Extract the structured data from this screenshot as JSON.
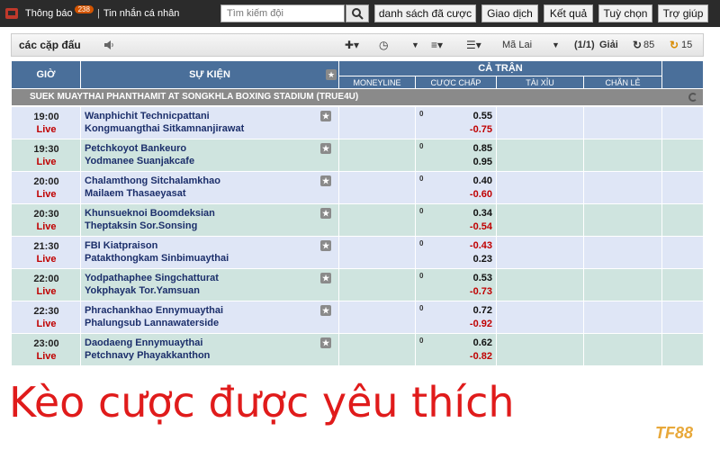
{
  "topbar": {
    "notifications_label": "Thông báo",
    "notifications_count": "238",
    "messages_label": "Tin nhắn cá nhân",
    "search_placeholder": "Tìm kiếm đội",
    "nav": [
      "danh sách đã cược",
      "Giao dịch",
      "Kết quả",
      "Tuỳ chọn",
      "Trợ giúp"
    ]
  },
  "toolbar": {
    "title": "các cặp đấu",
    "odds_type": "Mã Lai",
    "page": "(1/1)",
    "page_suffix": "Giải",
    "refresh_count": "85",
    "timer_count": "15"
  },
  "table": {
    "col_time": "GIỜ",
    "col_event": "SỰ KIỆN",
    "group_fulltime": "CẢ TRẬN",
    "sub_moneyline": "MONEYLINE",
    "sub_handicap": "CƯỢC CHẤP",
    "sub_overunder": "TÀI XỈU",
    "sub_oddeven": "CHẴN LẺ",
    "league": "SUEK MUAYTHAI PHANTHAMIT AT SONGKHLA BOXING STADIUM (TRUE4U)",
    "rows": [
      {
        "time": "19:00",
        "status": "Live",
        "home": "Wanphichit Technicpattani",
        "away": "Kongmuangthai Sitkamnanjirawat",
        "hdp": "0",
        "odd1": "0.55",
        "odd2": "-0.75"
      },
      {
        "time": "19:30",
        "status": "Live",
        "home": "Petchkoyot Bankeuro",
        "away": "Yodmanee Suanjakcafe",
        "hdp": "0",
        "odd1": "0.85",
        "odd2": "0.95"
      },
      {
        "time": "20:00",
        "status": "Live",
        "home": "Chalamthong Sitchalamkhao",
        "away": "Mailaem Thasaeyasat",
        "hdp": "0",
        "odd1": "0.40",
        "odd2": "-0.60"
      },
      {
        "time": "20:30",
        "status": "Live",
        "home": "Khunsueknoi Boomdeksian",
        "away": "Theptaksin Sor.Sonsing",
        "hdp": "0",
        "odd1": "0.34",
        "odd2": "-0.54"
      },
      {
        "time": "21:30",
        "status": "Live",
        "home": "FBI Kiatpraison",
        "away": "Patakthongkam Sinbimuaythai",
        "hdp": "0",
        "odd1": "-0.43",
        "odd2": "0.23"
      },
      {
        "time": "22:00",
        "status": "Live",
        "home": "Yodpathaphee Singchatturat",
        "away": "Yokphayak Tor.Yamsuan",
        "hdp": "0",
        "odd1": "0.53",
        "odd2": "-0.73"
      },
      {
        "time": "22:30",
        "status": "Live",
        "home": "Phrachankhao Ennymuaythai",
        "away": "Phalungsub Lannawaterside",
        "hdp": "0",
        "odd1": "0.72",
        "odd2": "-0.92"
      },
      {
        "time": "23:00",
        "status": "Live",
        "home": "Daodaeng Ennymuaythai",
        "away": "Petchnavy Phayakkanthon",
        "hdp": "0",
        "odd1": "0.62",
        "odd2": "-0.82"
      }
    ]
  },
  "caption": "Kèo cược được yêu thích",
  "logo": "TF88",
  "colors": {
    "header": "#4a6f9a",
    "live": "#c00000",
    "caption": "#e01b1b"
  }
}
